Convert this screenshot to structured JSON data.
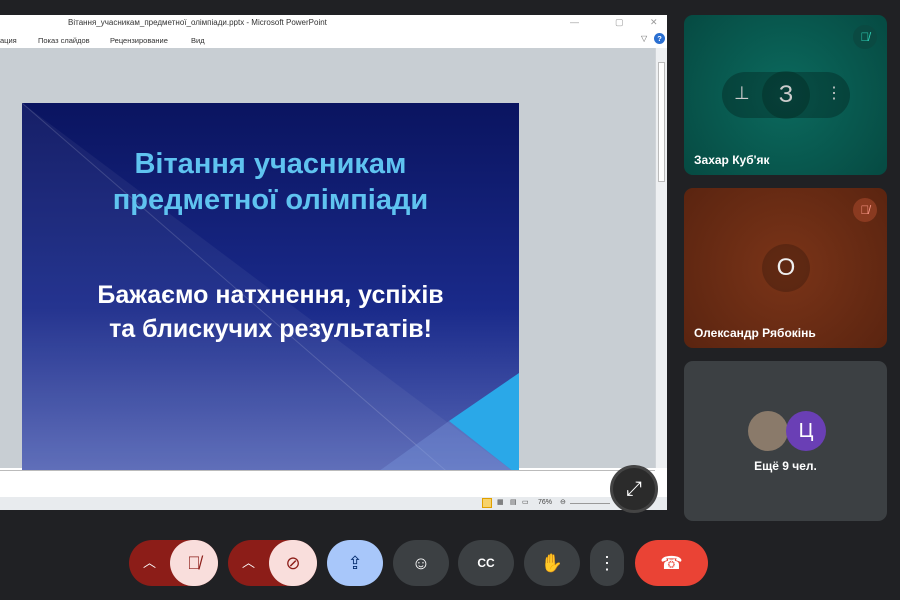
{
  "powerpoint": {
    "title": "Вітання_учасникам_предметної_олімпіади.pptx - Microsoft PowerPoint",
    "tabs": [
      "ация",
      "Показ слайдов",
      "Рецензирование",
      "Вид"
    ],
    "slide": {
      "heading_line1": "Вітання учасникам",
      "heading_line2": "предметної олімпіади",
      "sub_line1": "Бажаємо натхнення, успіхів",
      "sub_line2": "та блискучих результатів!"
    },
    "zoom": "76%"
  },
  "participants": [
    {
      "name": "Захар Куб'як",
      "initial": "З",
      "color": "#0b5c52"
    },
    {
      "name": "Олександр Рябокінь",
      "initial": "О",
      "color": "#6b2a14"
    }
  ],
  "others": {
    "label": "Ещё 9 чел.",
    "initial": "Ц"
  },
  "controls": {
    "accent_red": "#ea4335",
    "present_blue": "#a8c7fa"
  }
}
